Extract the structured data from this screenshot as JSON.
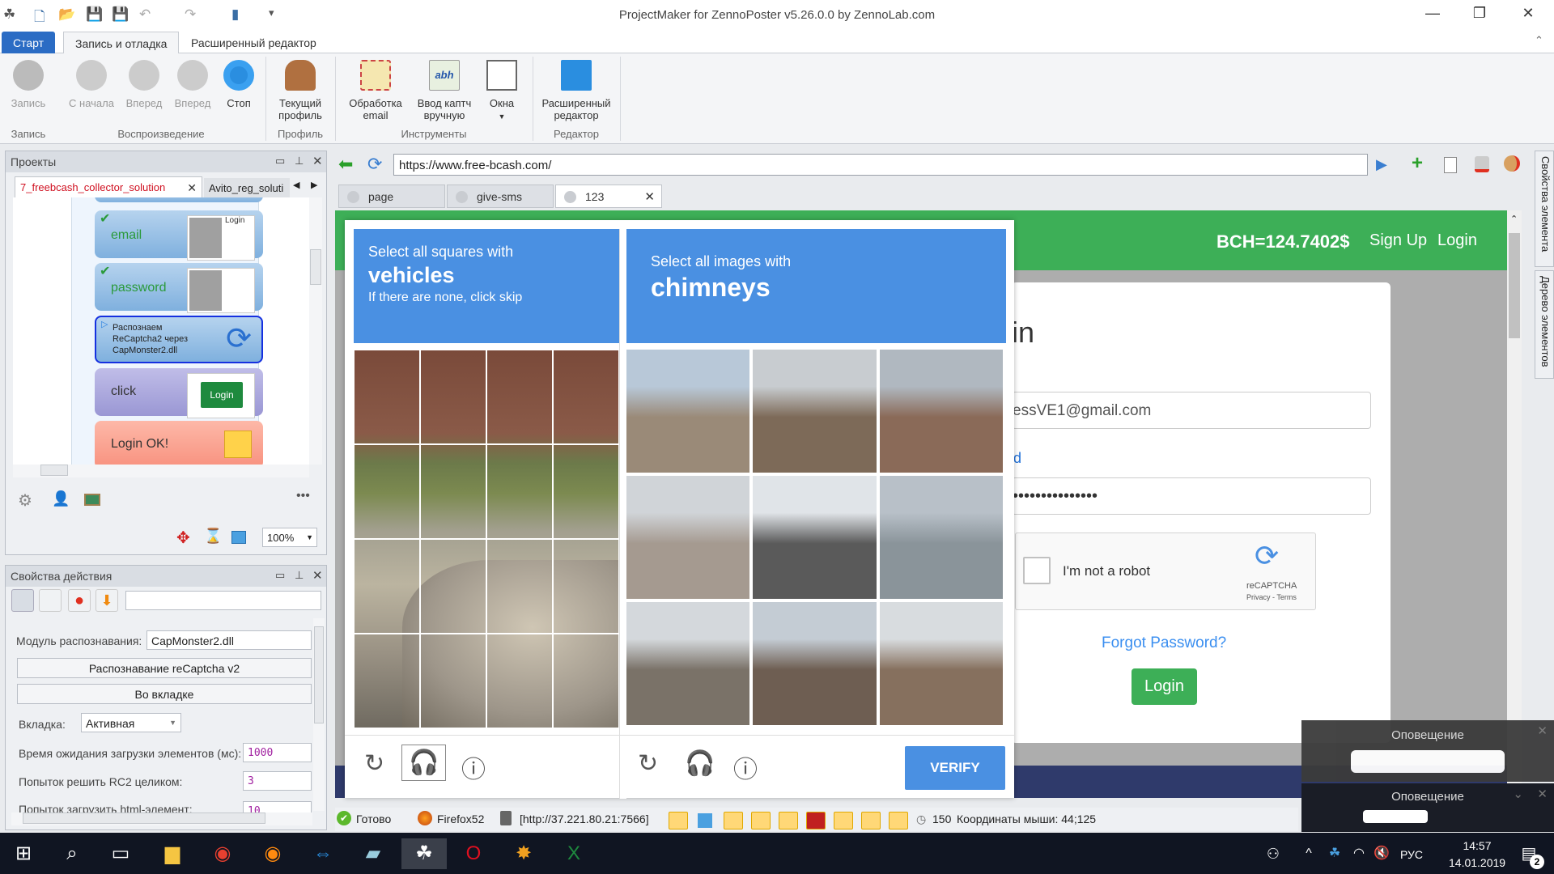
{
  "window": {
    "title": "ProjectMaker for ZennoPoster v5.26.0.0 by ZennoLab.com"
  },
  "ribbon_tabs": [
    "Старт",
    "Запись и отладка",
    "Расширенный редактор"
  ],
  "ribbon": {
    "buttons": [
      {
        "label": "Запись",
        "enabled": false
      },
      {
        "label": "С начала",
        "enabled": false
      },
      {
        "label": "Вперед",
        "enabled": false
      },
      {
        "label": "Вперед",
        "enabled": false
      },
      {
        "label": "Стоп",
        "enabled": true
      },
      {
        "label": "Текущий профиль",
        "enabled": true
      },
      {
        "label": "Обработка email",
        "enabled": true
      },
      {
        "label": "Ввод каптч вручную",
        "enabled": true
      },
      {
        "label": "Окна",
        "enabled": true
      },
      {
        "label": "Расширенный редактор",
        "enabled": true
      }
    ],
    "groups": [
      "Запись",
      "Воспроизведение",
      "Профиль",
      "Инструменты",
      "Редактор"
    ]
  },
  "projects": {
    "title": "Проекты",
    "tabs": [
      "7_freebcash_collector_solution",
      "Avito_reg_soluti"
    ],
    "blocks": [
      {
        "label": "email",
        "thumb": "Login"
      },
      {
        "label": "password"
      },
      {
        "label": "Распознаем ReCaptcha2 через CapMonster2.dll"
      },
      {
        "label": "click",
        "thumb": "Login"
      },
      {
        "label": "Login OK!"
      }
    ],
    "zoom": "100%"
  },
  "action_props": {
    "title": "Свойства действия",
    "module_label": "Модуль распознавания:",
    "module_value": "CapMonster2.dll",
    "btn_recaptcha": "Распознавание reCaptcha v2",
    "btn_tab": "Во вкладке",
    "tab_label": "Вкладка:",
    "tab_value": "Активная",
    "wait_label": "Время ожидания загрузки элементов (мс):",
    "wait_value": "1000",
    "attempts_label": "Попыток решить RC2 целиком:",
    "attempts_value": "3",
    "html_label": "Попыток загрузить html-элемент:",
    "html_value": "10"
  },
  "browser": {
    "url": "https://www.free-bcash.com/",
    "tabs": [
      "page",
      "give-sms",
      "123"
    ],
    "side_tabs": [
      "Свойства элемента",
      "Дерево элементов"
    ]
  },
  "site": {
    "balance": "BCH=124.7402$",
    "signup": "Sign Up",
    "login": "Login",
    "card_title": "in",
    "email_value": "essVE1@gmail.com",
    "pwd_label": "d",
    "pwd_value": "•••••••••••••••",
    "recaptcha_checkbox": "I'm not a robot",
    "recaptcha_brand": "reCAPTCHA",
    "recaptcha_links": "Privacy - Terms",
    "forgot": "Forgot Password?",
    "login_btn": "Login"
  },
  "captcha_left": {
    "line1": "Select all squares with",
    "object": "vehicles",
    "line3": "If there are none, click skip"
  },
  "captcha_right": {
    "line1": "Select all images with",
    "object": "chimneys",
    "verify": "VERIFY"
  },
  "notifications": [
    {
      "title": "Оповещение"
    },
    {
      "title": "Оповещение"
    }
  ],
  "status": {
    "ready": "Готово",
    "browser": "Firefox52",
    "proxy": "[http://37.221.80.21:7566]",
    "count": "150",
    "mouse": "Координаты мыши: 44;125"
  },
  "tray": {
    "lang": "РУС",
    "time": "14:57",
    "date": "14.01.2019",
    "notif_count": "2"
  },
  "colors": {
    "accent": "#2b6cc4",
    "captcha_blue": "#4a90e2",
    "site_green": "#3daf57",
    "footer_navy": "#2f3a6b"
  }
}
